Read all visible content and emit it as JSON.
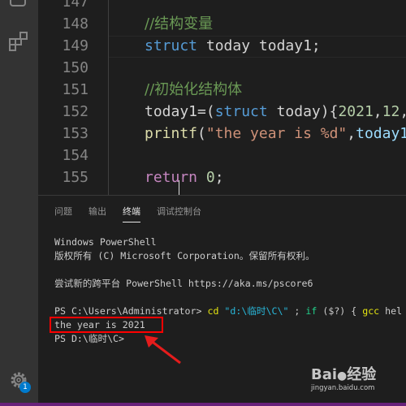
{
  "editor": {
    "lines": [
      {
        "n": "147"
      },
      {
        "n": "148",
        "comment": "//结构变量"
      },
      {
        "n": "149",
        "kw": "struct",
        "rest": " today today1;"
      },
      {
        "n": "150"
      },
      {
        "n": "151",
        "comment": "//初始化结构体"
      },
      {
        "n": "152",
        "a": "today1=(",
        "kw": "struct",
        "b": " today){",
        "num": "2021",
        "c": ",",
        "num2": "12",
        "d": ","
      },
      {
        "n": "153",
        "fn": "printf",
        "a": "(",
        "str": "\"the year is %d\"",
        "b": ",",
        "var": "today1"
      },
      {
        "n": "154"
      },
      {
        "n": "155",
        "kw": "return",
        "rest": " ",
        "num": "0",
        "d": ";"
      }
    ]
  },
  "panel": {
    "tabs": [
      "问题",
      "输出",
      "终端",
      "调试控制台"
    ],
    "active_tab": "终端",
    "terminal": {
      "l1": "Windows PowerShell",
      "l2": "版权所有 (C) Microsoft Corporation。保留所有权利。",
      "l3": "尝试新的跨平台 PowerShell https://aka.ms/pscore6",
      "prompt1": "PS C:\\Users\\Administrator> ",
      "cmd_cd": "cd",
      "cmd_path": " \"d:\\临时\\C\\\"",
      "cmd_semi": " ; ",
      "cmd_if": "if",
      "cmd_cond": " ($?) { ",
      "cmd_gcc": "gcc",
      "cmd_rest": " hel",
      "output": "the year is 2021",
      "prompt2": "PS D:\\临时\\C>"
    }
  },
  "activity": {
    "settings_badge": "1"
  },
  "watermark": {
    "logo": "Baidu经验",
    "url": "jingyan.baidu.com"
  },
  "colors": {
    "annotation": "#ff0000",
    "status_bar": "#68217a"
  }
}
